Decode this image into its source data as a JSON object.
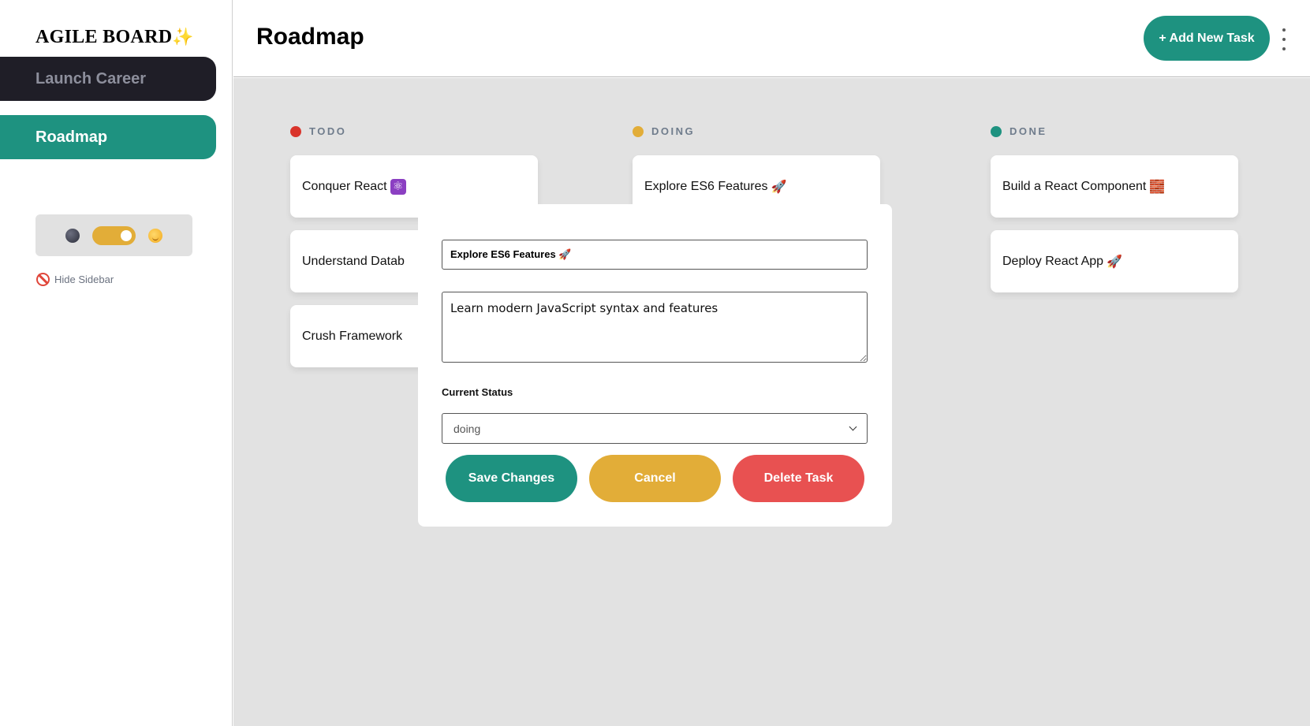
{
  "sidebar": {
    "brand": "AGILE BOARD",
    "brand_sparkle": "✨",
    "boards": [
      {
        "label": "Launch Career"
      },
      {
        "label": "Roadmap"
      }
    ],
    "hide_sidebar_label": "Hide Sidebar",
    "theme_toggle": {
      "state": "light",
      "left_icon": "moon-icon",
      "right_icon": "sun-icon"
    }
  },
  "header": {
    "title": "Roadmap",
    "add_task_label": "+ Add New Task"
  },
  "columns": [
    {
      "name": "TODO",
      "color": "#d9342b",
      "cards": [
        {
          "title": "Conquer React",
          "emoji": "⚛"
        },
        {
          "title": "Understand Datab"
        },
        {
          "title": "Crush Framework"
        }
      ]
    },
    {
      "name": "DOING",
      "color": "#e2ad38",
      "cards": [
        {
          "title": "Explore ES6 Features",
          "emoji": "🚀"
        }
      ]
    },
    {
      "name": "DONE",
      "color": "#1e9280",
      "cards": [
        {
          "title": "Build a React Component",
          "emoji": "🧱"
        },
        {
          "title": "Deploy React App",
          "emoji": "🚀"
        }
      ]
    }
  ],
  "modal": {
    "title_value": "Explore ES6 Features 🚀",
    "description_value": "Learn modern JavaScript syntax and features",
    "status_label": "Current Status",
    "status_value": "doing",
    "save_label": "Save Changes",
    "cancel_label": "Cancel",
    "delete_label": "Delete Task"
  },
  "colors": {
    "accent": "#1e9280",
    "warning": "#e2ad38",
    "danger": "#e85151",
    "sidebar_dark": "#1f1e27",
    "board_bg": "#e2e2e2"
  }
}
